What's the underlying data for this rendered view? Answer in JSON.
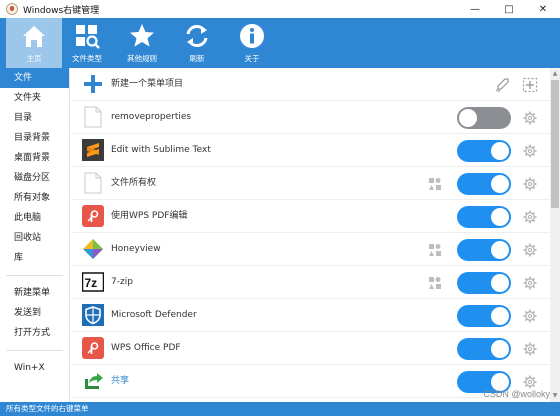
{
  "window": {
    "title": "Windows右键管理",
    "minimize": "—",
    "maximize": "□",
    "close": "✕"
  },
  "toolbar": [
    {
      "label": "主页",
      "icon": "home-icon"
    },
    {
      "label": "文件类型",
      "icon": "file-types-icon"
    },
    {
      "label": "其他规则",
      "icon": "star-icon"
    },
    {
      "label": "刷新",
      "icon": "refresh-icon"
    },
    {
      "label": "关于",
      "icon": "info-icon"
    }
  ],
  "sidebar": {
    "group1": [
      "文件",
      "文件夹",
      "目录",
      "目录背景",
      "桌面背景",
      "磁盘分区",
      "所有对象",
      "此电脑",
      "回收站",
      "库"
    ],
    "group2": [
      "新建菜单",
      "发送到",
      "打开方式"
    ],
    "group3": [
      "Win+X"
    ],
    "selected": "文件"
  },
  "list": {
    "header_label": "新建一个菜单项目",
    "items": [
      {
        "label": "removeproperties",
        "icon": "blank-file-icon",
        "enabled": false,
        "badge": false
      },
      {
        "label": "Edit with Sublime Text",
        "icon": "sublime-text-icon",
        "enabled": true,
        "badge": false
      },
      {
        "label": "文件所有权",
        "icon": "blank-file-icon",
        "enabled": true,
        "badge": true
      },
      {
        "label": "使用WPS PDF编辑",
        "icon": "wps-pdf-icon",
        "enabled": true,
        "badge": false
      },
      {
        "label": "Honeyview",
        "icon": "honeyview-icon",
        "enabled": true,
        "badge": true
      },
      {
        "label": "7-zip",
        "icon": "7zip-icon",
        "enabled": true,
        "badge": true
      },
      {
        "label": "Microsoft Defender",
        "icon": "defender-shield-icon",
        "enabled": true,
        "badge": false
      },
      {
        "label": "WPS Office PDF",
        "icon": "wps-pdf-icon",
        "enabled": true,
        "badge": false
      },
      {
        "label": "共享",
        "icon": "share-arrow-icon",
        "enabled": true,
        "badge": false
      }
    ]
  },
  "statusbar": {
    "text": "所有类型文件的右键菜单"
  },
  "watermark": "CSDN @wolloky",
  "colors": {
    "accent": "#2f87d3",
    "toggle_on": "#1f8ff0",
    "toggle_off": "#8b8f93"
  }
}
